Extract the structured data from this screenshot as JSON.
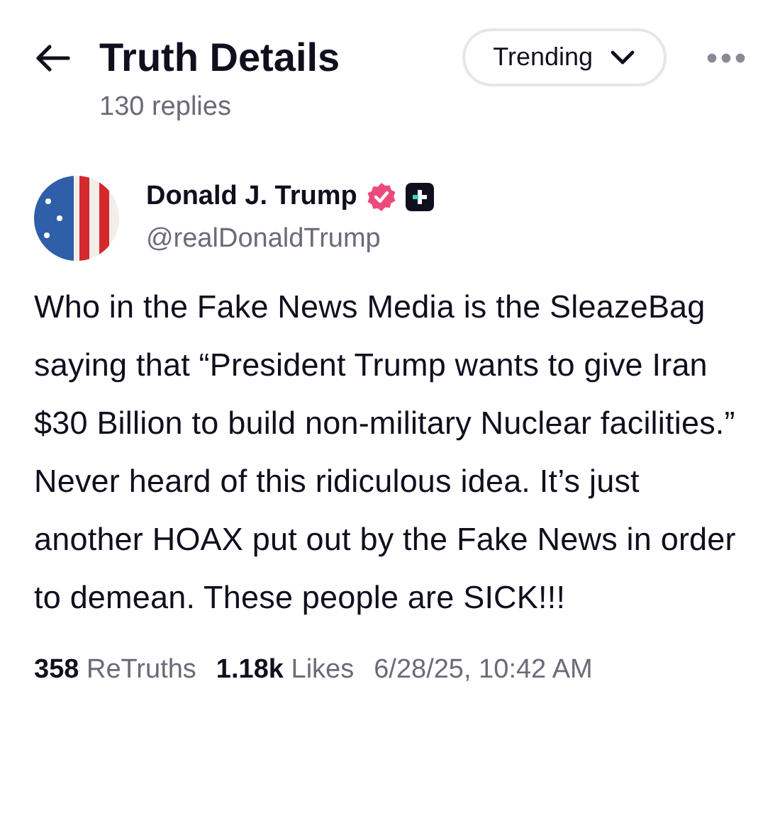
{
  "header": {
    "title": "Truth Details",
    "subtitle": "130 replies",
    "sort": "Trending"
  },
  "post": {
    "author": "Donald J. Trump",
    "verified": true,
    "handle": "@realDonaldTrump",
    "body": "Who in the Fake News Media is the SleazeBag saying that “President Trump wants to give Iran $30 Billion to build non-military Nuclear facilities.” Never heard of this ridiculous idea. It’s just another HOAX put out by the Fake News in order to demean. These people are SICK!!!",
    "stats": [
      {
        "count": "358",
        "label": "ReTruths"
      },
      {
        "count": "1.18k",
        "label": "Likes"
      }
    ],
    "timestamp": "6/28/25, 10:42 AM"
  }
}
